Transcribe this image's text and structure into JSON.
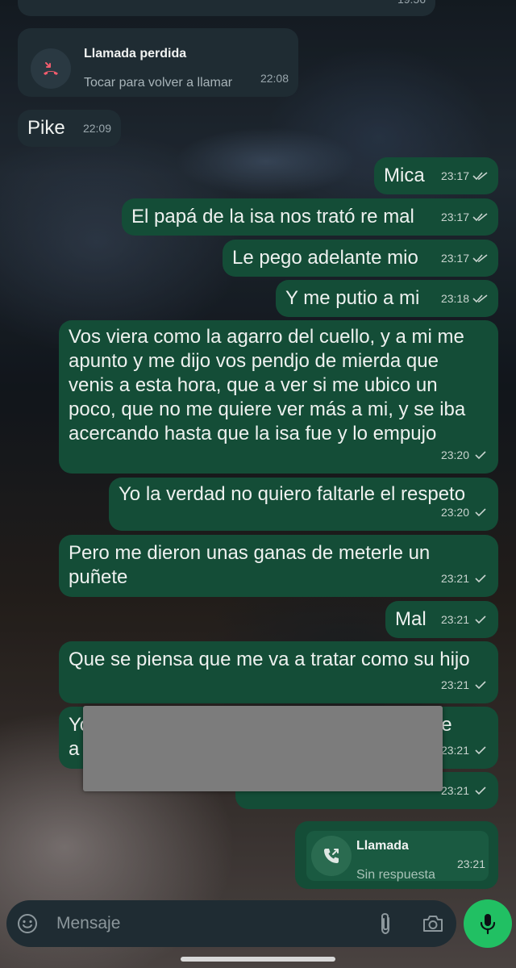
{
  "messages": [
    {
      "text": "",
      "time": "19:56"
    },
    {
      "type": "missed-call",
      "title": "Llamada perdida",
      "subtitle": "Tocar para volver a llamar",
      "time": "22:08"
    },
    {
      "text": "Pike",
      "time": "22:09"
    },
    {
      "text": "Mica",
      "time": "23:17",
      "status": "read"
    },
    {
      "text": "El papá de la isa nos trató re mal",
      "time": "23:17",
      "status": "read"
    },
    {
      "text": "Le pego adelante mio",
      "time": "23:17",
      "status": "read"
    },
    {
      "text": "Y me putio a mi",
      "time": "23:18",
      "status": "read"
    },
    {
      "text": "Vos viera como la agarro del cuello, y a mi me apunto y me dijo vos pendjo de mierda que venis a esta hora, que a ver si me ubico un poco, que no me quiere ver más a mi, y se iba acercando hasta que la isa fue y lo empujo",
      "time": "23:20",
      "status": "sent"
    },
    {
      "text": "Yo la verdad no quiero faltarle el respeto",
      "time": "23:20",
      "status": "sent"
    },
    {
      "text": "Pero me dieron unas ganas de meterle un puñete",
      "time": "23:21",
      "status": "sent"
    },
    {
      "text": "Mal",
      "time": "23:21",
      "status": "sent"
    },
    {
      "text": "Que se piensa que me va a tratar como su hijo",
      "time": "23:21",
      "status": "sent"
    },
    {
      "text_start": "Yo",
      "text_start2": "a",
      "text_end": "ve",
      "time": "23:21",
      "status": "sent"
    },
    {
      "text": "",
      "time": "23:21",
      "status": "sent"
    },
    {
      "type": "outgoing-call",
      "title": "Llamada",
      "subtitle": "Sin respuesta",
      "time": "23:21"
    }
  ],
  "composer": {
    "placeholder": "Mensaje",
    "emoji_icon": "emoji-icon",
    "attach_icon": "paperclip-icon",
    "camera_icon": "camera-icon",
    "mic_icon": "microphone-icon"
  },
  "colors": {
    "outgoing_bubble": "#144d37",
    "incoming_bubble": "#1f2c33",
    "accent_green": "#21c063",
    "missed_call_red": "#f15c6d"
  }
}
